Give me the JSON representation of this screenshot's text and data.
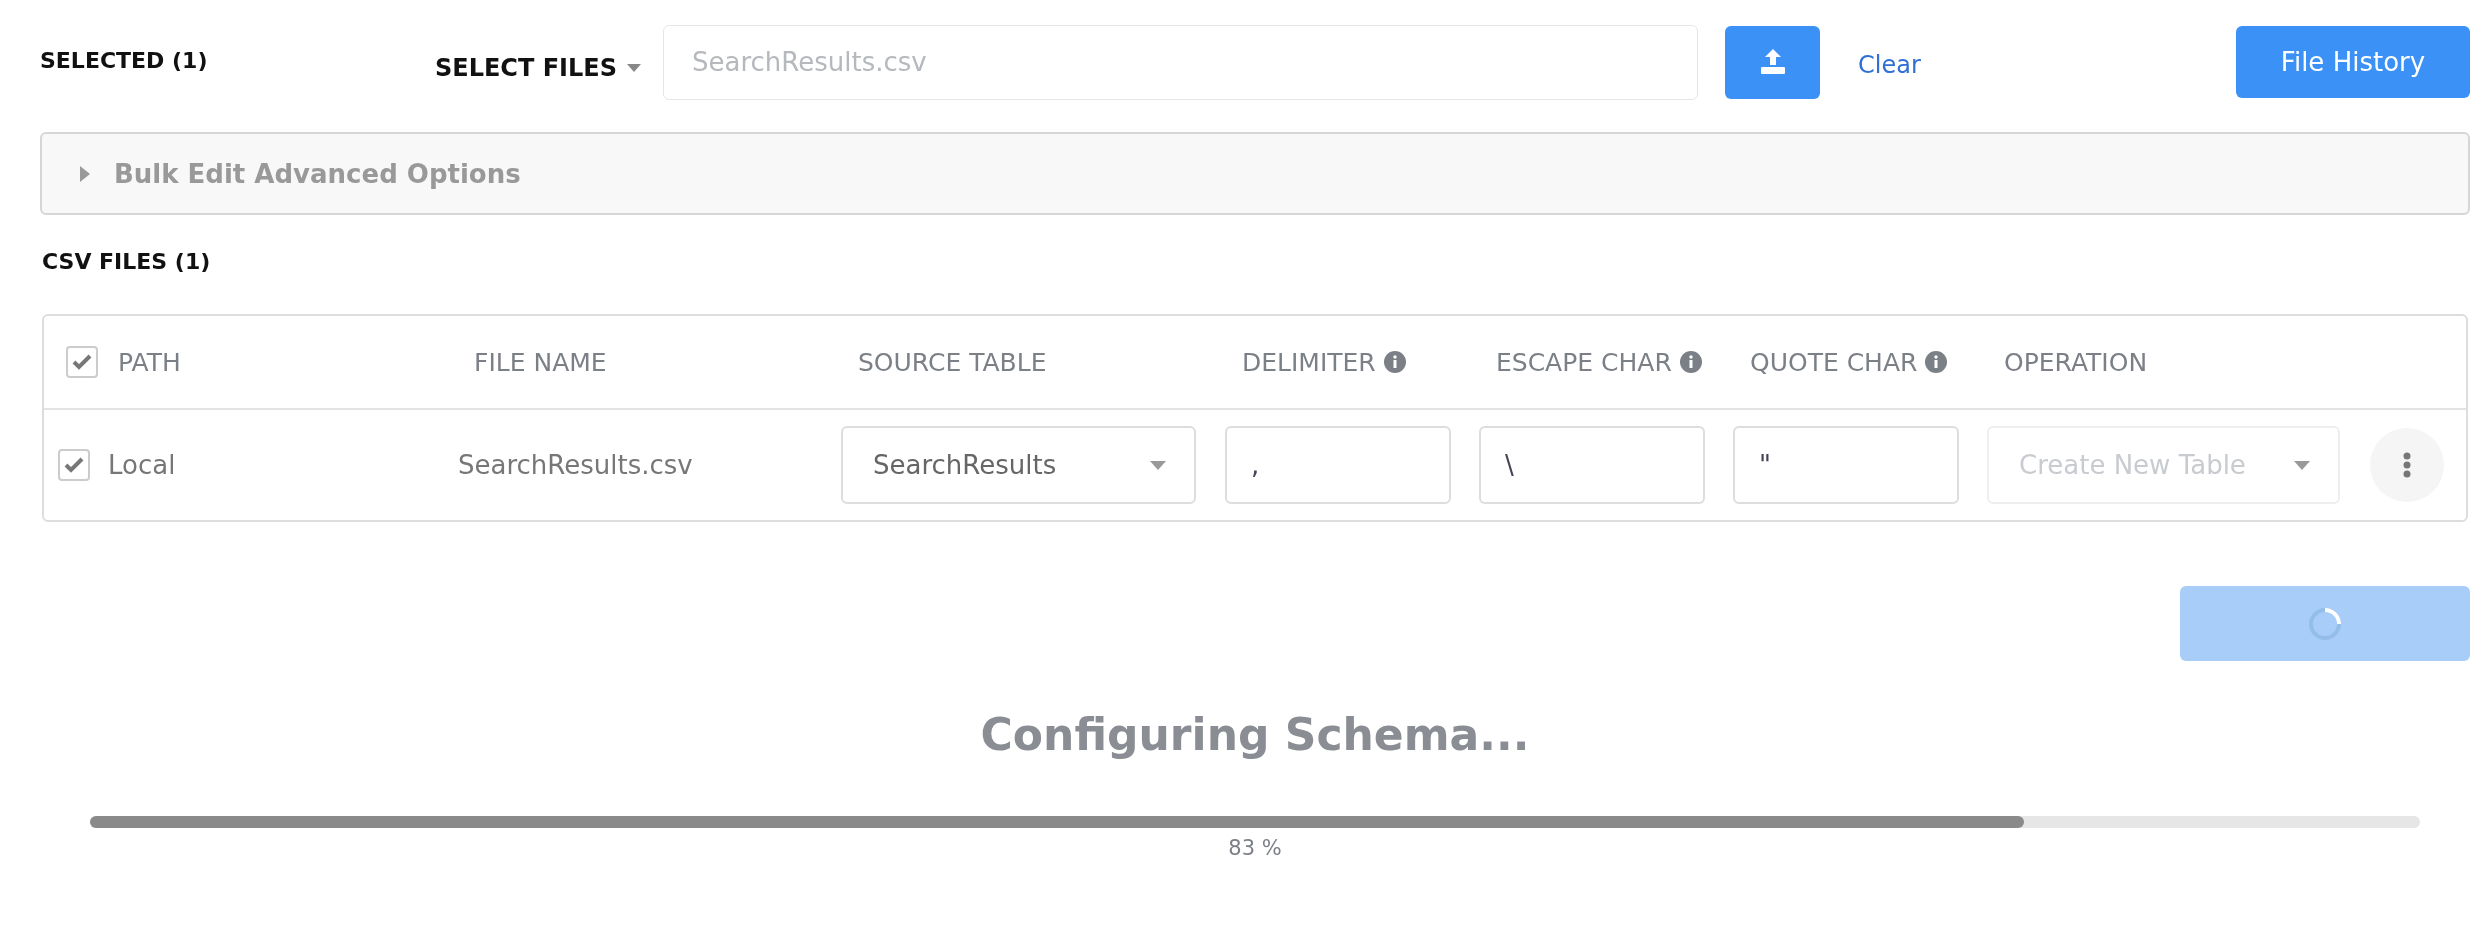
{
  "selected_label": "SELECTED (1)",
  "select_files": {
    "label": "SELECT FILES"
  },
  "file_field": {
    "placeholder": "SearchResults.csv"
  },
  "clear_link": "Clear",
  "file_history_button": "File History",
  "advanced_options": {
    "label": "Bulk Edit Advanced Options",
    "expanded": false
  },
  "csv_files_label": "CSV FILES (1)",
  "table": {
    "all_checked": true,
    "columns": [
      {
        "label": "PATH",
        "info": false
      },
      {
        "label": "FILE NAME",
        "info": false
      },
      {
        "label": "SOURCE TABLE",
        "info": false
      },
      {
        "label": "DELIMITER",
        "info": true
      },
      {
        "label": "ESCAPE CHAR",
        "info": true
      },
      {
        "label": "QUOTE CHAR",
        "info": true
      },
      {
        "label": "OPERATION",
        "info": false
      }
    ],
    "rows": [
      {
        "checked": true,
        "path": "Local",
        "file_name": "SearchResults.csv",
        "source_table": "SearchResults",
        "delimiter": ",",
        "escape_char": "\\",
        "quote_char": "\"",
        "operation": {
          "placeholder": "Create New Table",
          "disabled": true
        }
      }
    ]
  },
  "submit_button": {
    "loading": true
  },
  "progress": {
    "title": "Configuring Schema...",
    "level": 0.83,
    "reading": "83 %"
  }
}
